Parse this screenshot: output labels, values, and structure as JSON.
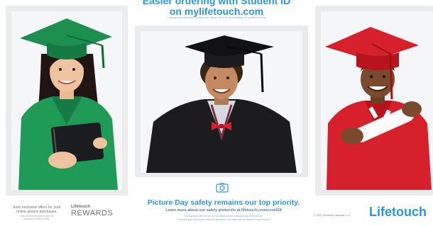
{
  "header": {
    "line1": "Easier ordering with Student ID",
    "line2_prefix": "on ",
    "line2_link": "mylifetouch.com",
    "fine_print": "Catálogo para hacemos. Pedidos más fáciles con tu ID del estudiante en mylifetouch.com"
  },
  "safety": {
    "title": "Picture Day safety remains our top priority.",
    "subtitle": "Learn more about our safety protocols at lifetouch.com/covid19",
    "es_line1": "La seguridad del Día de la Foto sigue siendo nuestra máxima prioridad.",
    "es_line2": "Conozca algo más sobre nuestros protocolos de seguridad en lifetouch.com/covid19"
  },
  "rewards": {
    "text_en_1": "Earn exclusive offers for your",
    "text_en_2": "online picture purchases.",
    "text_es_1": "Gana ofertas exclusivas para tus",
    "text_es_2": "compras de fotos en línea.",
    "brand_top": "Lifetouch",
    "brand_bottom": "REWARDS"
  },
  "footer": {
    "copyright": "© 2022 Shutterfly Lifetouch, LLC",
    "logo": "Lifetouch"
  },
  "colors": {
    "brand_blue": "#2a97d6",
    "gown_green": "#1f9a57",
    "gown_black": "#1c1c1e",
    "gown_red": "#d6202b"
  }
}
